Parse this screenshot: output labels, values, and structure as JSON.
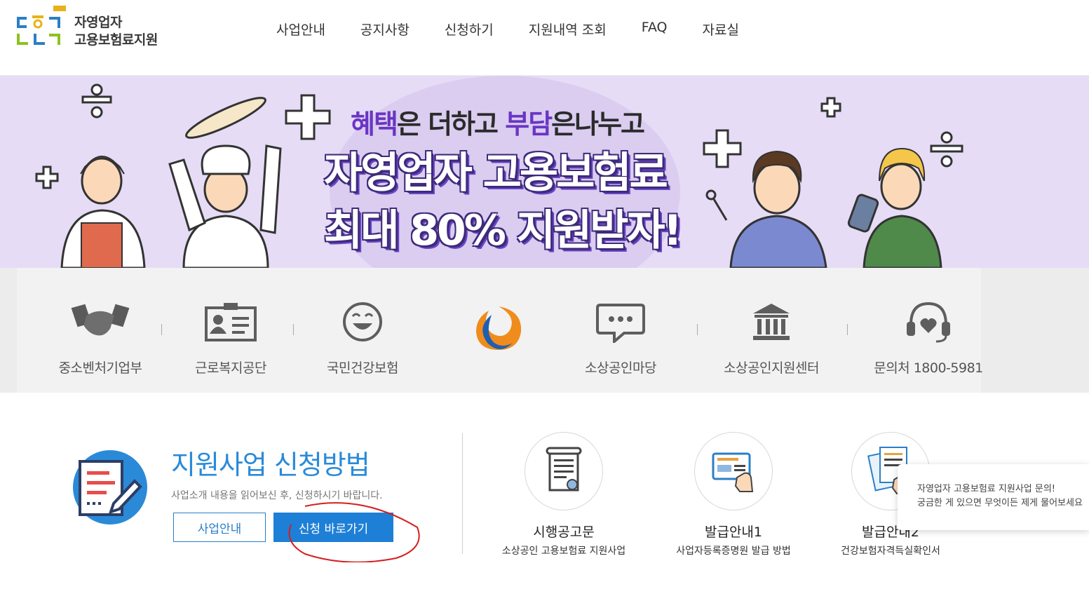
{
  "header": {
    "logo_line1": "자영업자",
    "logo_line2": "고용보험료지원",
    "nav": [
      "사업안내",
      "공지사항",
      "신청하기",
      "지원내역 조회",
      "FAQ",
      "자료실"
    ]
  },
  "banner": {
    "sub_part1": "혜택",
    "sub_part2": "은 더하고 ",
    "sub_part3": "부담",
    "sub_part4": "은나누고",
    "title_line1": "자영업자 고용보험료",
    "title_line2": "최대 80% 지원받자!"
  },
  "links": [
    {
      "label": "중소벤처기업부",
      "icon": "handshake-icon"
    },
    {
      "label": "근로복지공단",
      "icon": "id-card-icon"
    },
    {
      "label": "국민건강보험",
      "icon": "smile-icon"
    },
    {
      "label": "",
      "icon": "kcomwel-logo-icon"
    },
    {
      "label": "소상공인마당",
      "icon": "chat-bubble-icon"
    },
    {
      "label": "소상공인지원센터",
      "icon": "bank-icon"
    },
    {
      "label": "문의처 1800-5981",
      "icon": "headset-icon"
    }
  ],
  "apply": {
    "title": "지원사업 신청방법",
    "desc": "사업소개 내용을 읽어보신 후, 신청하시기 바랍니다.",
    "btn_info": "사업안내",
    "btn_apply": "신청 바로가기"
  },
  "docs": [
    {
      "title": "시행공고문",
      "sub": "소상공인 고용보험료 지원사업",
      "icon": "scroll-document-icon"
    },
    {
      "title": "발급안내1",
      "sub": "사업자등록증명원 발급 방법",
      "icon": "certificate-hand-icon"
    },
    {
      "title": "발급안내2",
      "sub": "건강보험자격득실확인서",
      "icon": "documents-hand-icon"
    }
  ],
  "chat": {
    "line1": "자영업자 고용보험료 지원사업 문의!",
    "line2": "궁금한 게 있으면 무엇이든 제게 물어보세요"
  },
  "colors": {
    "accent": "#2a8ad8",
    "banner_bg": "#e6dcf6",
    "banner_purple": "#6a35c4",
    "button": "#1e7fd6"
  }
}
